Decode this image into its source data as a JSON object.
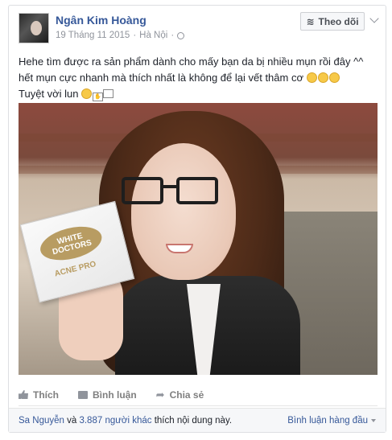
{
  "post": {
    "author": "Ngân Kim Hoàng",
    "date": "19 Tháng 11 2015",
    "location": "Hà Nội",
    "separator": "·",
    "follow_label": "Theo dõi",
    "text_line1": "Hehe tìm được ra sản phẩm dành cho mấy bạn da bị nhiều mụn rồi đây ^^",
    "text_line2": "hết mụn cực nhanh mà thích nhất là không để lại vết thâm cơ",
    "text_line3": "Tuyệt vời lun"
  },
  "product": {
    "brand": "WHITE DOCTORS",
    "name": "ACNE PRO"
  },
  "actions": {
    "like": "Thích",
    "comment": "Bình luận",
    "share": "Chia sẻ"
  },
  "footer": {
    "liker": "Sa Nguyễn",
    "conj": "và",
    "others": "3.887 người khác",
    "suffix": "thích nội dung này.",
    "sort": "Bình luận hàng đầu"
  },
  "icons": [
    "globe-icon",
    "rss-icon",
    "chevron-down-icon",
    "like-icon",
    "comment-icon",
    "share-icon",
    "smiley-emoji-icon"
  ]
}
